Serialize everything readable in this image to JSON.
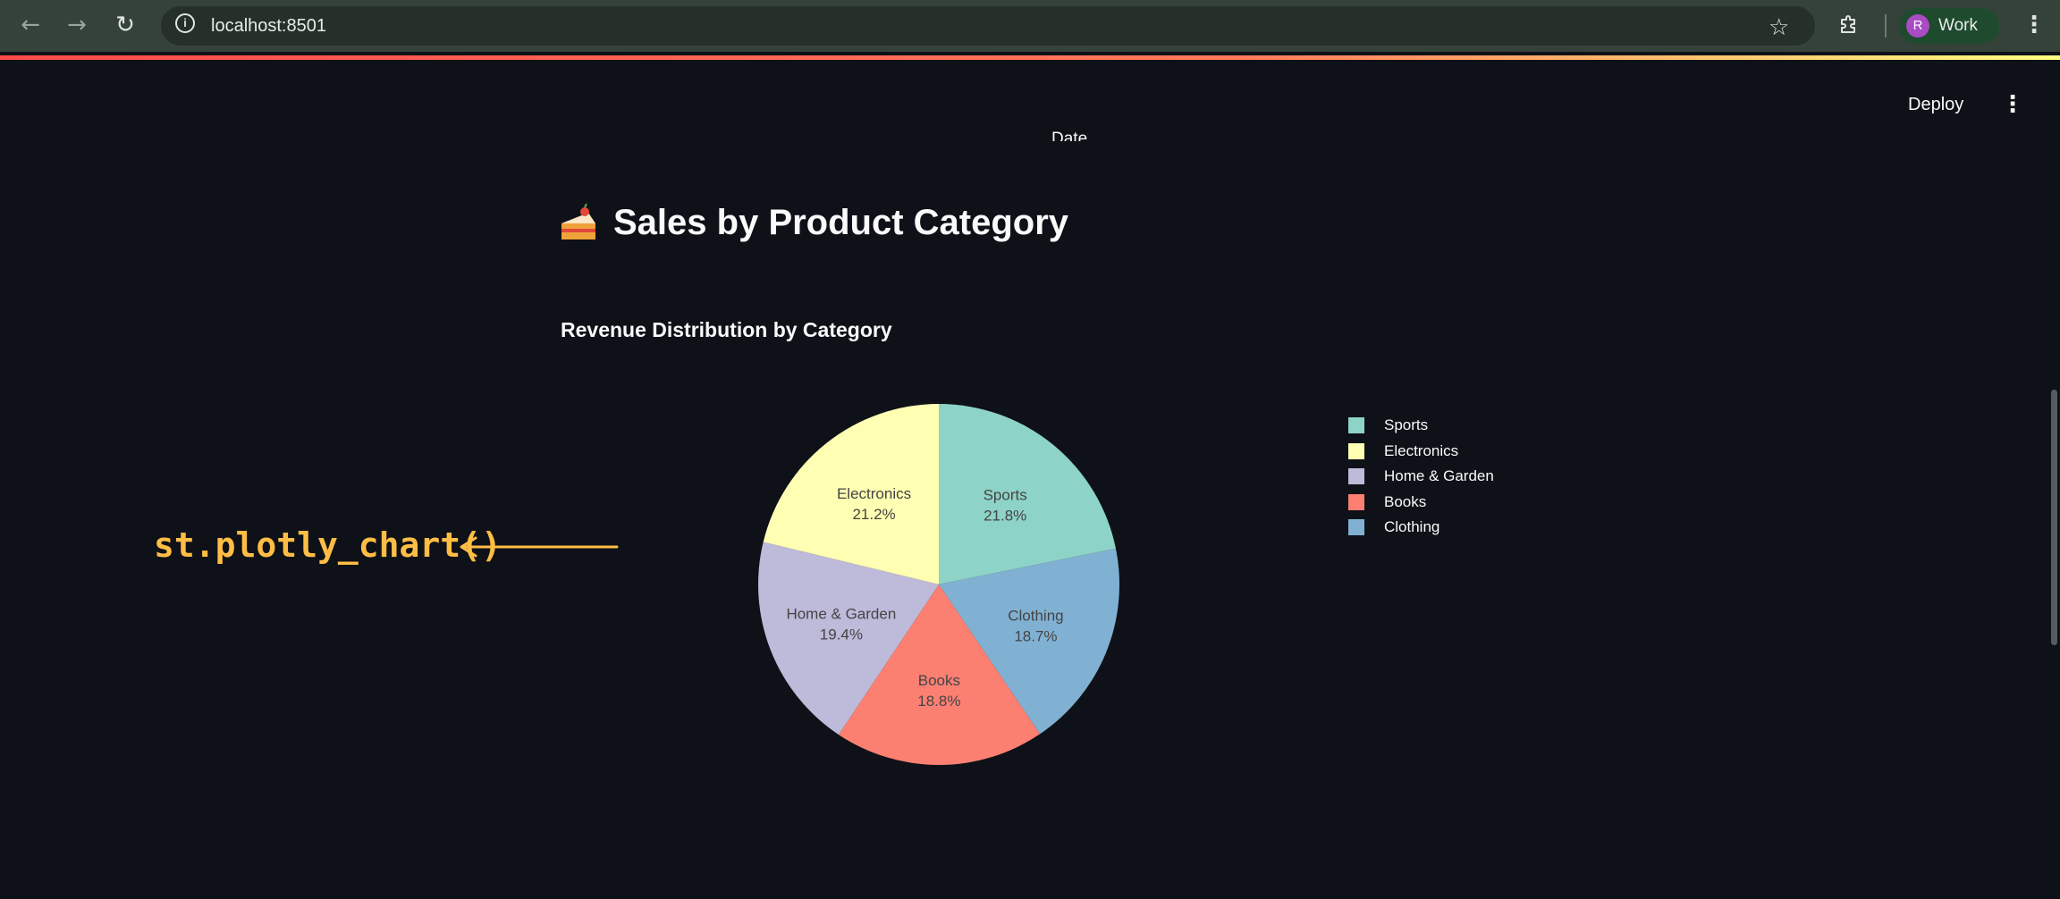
{
  "browser": {
    "url": "localhost:8501",
    "profile_initial": "R",
    "profile_label": "Work",
    "back_glyph": "←",
    "forward_glyph": "→",
    "reload_glyph": "↻",
    "info_glyph": "i",
    "star_glyph": "☆",
    "menu_glyph": "⋮",
    "icons": [
      "back-arrow-icon",
      "forward-arrow-icon",
      "reload-icon",
      "site-info-icon",
      "bookmark-star-icon",
      "extensions-icon",
      "browser-menu-icon"
    ]
  },
  "app_header": {
    "deploy_label": "Deploy",
    "menu_glyph": "⋮"
  },
  "clipped_label": "Date",
  "page": {
    "title": "Sales by Product Category",
    "title_icon": "cake-icon",
    "subheader": "Revenue Distribution by Category"
  },
  "annotation": {
    "text": "st.plotly_chart()",
    "color": "#ffbd45"
  },
  "chart_data": {
    "type": "pie",
    "title": "",
    "slices": [
      {
        "label": "Sports",
        "percent": 21.8,
        "percent_label": "21.8%",
        "color": "#8dd3c7"
      },
      {
        "label": "Clothing",
        "percent": 18.7,
        "percent_label": "18.7%",
        "color": "#80b1d3"
      },
      {
        "label": "Books",
        "percent": 18.8,
        "percent_label": "18.8%",
        "color": "#fb8072"
      },
      {
        "label": "Home & Garden",
        "percent": 19.4,
        "percent_label": "19.4%",
        "color": "#bebada"
      },
      {
        "label": "Electronics",
        "percent": 21.2,
        "percent_label": "21.2%",
        "color": "#ffffb3"
      }
    ],
    "legend": {
      "placement": "right",
      "entries": [
        {
          "label": "Sports",
          "color": "#8dd3c7"
        },
        {
          "label": "Electronics",
          "color": "#ffffb3"
        },
        {
          "label": "Home & Garden",
          "color": "#bebada"
        },
        {
          "label": "Books",
          "color": "#fb8072"
        },
        {
          "label": "Clothing",
          "color": "#80b1d3"
        }
      ]
    }
  }
}
